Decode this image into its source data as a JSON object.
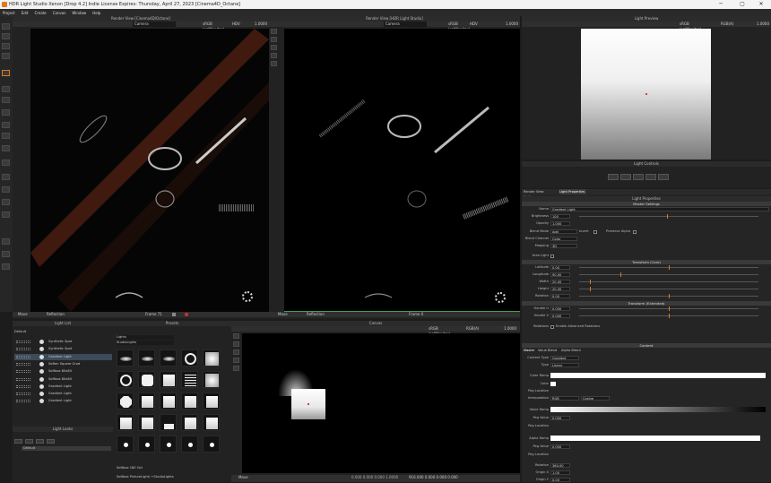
{
  "app": {
    "title": "HDR Light Studio Xenon [Drop 4.2] Indie License Expires: Thursday, April 27, 2023  [Cinema4D_Octane]"
  },
  "window_controls": {
    "minimize": "─",
    "maximize": "▢",
    "close": "✕"
  },
  "menu": [
    "Project",
    "Edit",
    "Create",
    "Canvas",
    "Window",
    "Help"
  ],
  "render_view_1": {
    "title": "Render View [Cinema4D/Octane]",
    "camera": "Camera",
    "color_space": "sRGB (sglMonitor)",
    "hdv": "HDV",
    "exposure": "1.0000",
    "mode": "Move",
    "view": "Reflection",
    "frame": "Frame 71"
  },
  "render_view_2": {
    "title": "Render View [HDR Light Studio]",
    "camera": "Camera",
    "color_space": "sRGB (sglMonitor)",
    "hdv": "HDV",
    "exposure": "1.0000",
    "mode": "Move",
    "view": "Reflection",
    "frame": "Frame 0"
  },
  "light_preview": {
    "title": "Light Preview",
    "color_space": "sRGB (sglMonitor)",
    "channel": "RGB(A)",
    "exposure": "1.0000"
  },
  "light_controls": {
    "title": "Light Controls"
  },
  "light_list": {
    "title": "Light List",
    "preset": "Default",
    "items": [
      {
        "name": "Synthetic Spot",
        "selected": false
      },
      {
        "name": "Synthetic Spot",
        "selected": false
      },
      {
        "name": "Gradient Light",
        "selected": true
      },
      {
        "name": "Soften Square Grad",
        "selected": false
      },
      {
        "name": "Softbox 80x80",
        "selected": false
      },
      {
        "name": "Softbox 80x80",
        "selected": false
      },
      {
        "name": "Gradient Light",
        "selected": false
      },
      {
        "name": "Gradient Light",
        "selected": false
      },
      {
        "name": "Gradient Light",
        "selected": false
      }
    ]
  },
  "light_looks": {
    "title": "Light Looks",
    "item": "Default"
  },
  "presets": {
    "title": "Presets",
    "category": "Lights",
    "subcategory": "StudioLights",
    "info_name": "Softbox  180 Oct",
    "info_path": "Softbox PictureLight/ +StudioLights"
  },
  "canvas": {
    "title": "Canvas",
    "color_space": "sRGB (sglMonitor)",
    "channel": "RGB(A)",
    "exposure": "1.0000",
    "mode": "Move",
    "readout": "0.000  0.000  0.000  1.0000",
    "coords": "916.000  0.000  0.000  0.000"
  },
  "properties": {
    "tabs": [
      "Render View Settings",
      "Light Properties"
    ],
    "active_tab": "Light Properties",
    "title": "Light Properties",
    "master_settings": "Master Settings",
    "name_label": "Name",
    "name_value": "Gradient Light",
    "brightness_label": "Brightness",
    "brightness_value": "100",
    "opacity_label": "Opacity",
    "opacity_value": "1.000",
    "blend_mode_label": "Blend Mode",
    "blend_mode_value": "Add",
    "invert_label": "Invert",
    "preserve_alpha_label": "Preserve Alpha",
    "blend_channel_label": "Blend Channel",
    "blend_channel_value": "Color",
    "mapping_label": "Mapping",
    "mapping_value": "3D",
    "area_light_label": "Area Light",
    "transform_core": "Transform (Core)",
    "latitude_label": "Latitude",
    "latitude_value": "0.00",
    "longitude_label": "Longitude",
    "longitude_value": "90.00",
    "width_label": "Width",
    "width_value": "20.00",
    "height_label": "Height",
    "height_value": "20.00",
    "rotation_label": "Rotation",
    "rotation_value": "0.00",
    "transform_extended": "Transform (Extended)",
    "handle_u_label": "Handle U",
    "handle_u_value": "0.000",
    "handle_v_label": "Handle V",
    "handle_v_value": "0.000",
    "rotations_label": "Rotations",
    "enable_advanced_label": "Enable Advanced Rotations",
    "content_title": "Content",
    "content_tabs": [
      "Master",
      "Value Blend",
      "Alpha Blend"
    ],
    "content_type_label": "Content Type",
    "content_type_value": "Gradient",
    "type_label": "Type",
    "type_value": "Linear",
    "color_ramp_label": "Color Ramp",
    "color_label": "Color",
    "peg_location_label": "Peg Location",
    "interpolation_label": "Interpolation",
    "interpolation_value": "RGB",
    "interpolation_curve": "Cosine",
    "value_ramp_label": "Value Ramp",
    "peg_value_label": "Peg Value",
    "peg_value_value": "0.000",
    "peg_location2_label": "Peg Location",
    "alpha_ramp_label": "Alpha Ramp",
    "peg_value2_label": "Peg Value",
    "peg_value2_value": "0.000",
    "peg_location3_label": "Peg Location",
    "rotation2_label": "Rotation",
    "rotation2_value": "360.00",
    "origin_x_label": "Origin X",
    "origin_x_value": "1.00",
    "origin_y_label": "Origin Y",
    "origin_y_value": "0.00"
  },
  "colors": {
    "accent": "#d87a2a",
    "selection": "#3c4a5a",
    "panel": "#2b2b2b"
  }
}
